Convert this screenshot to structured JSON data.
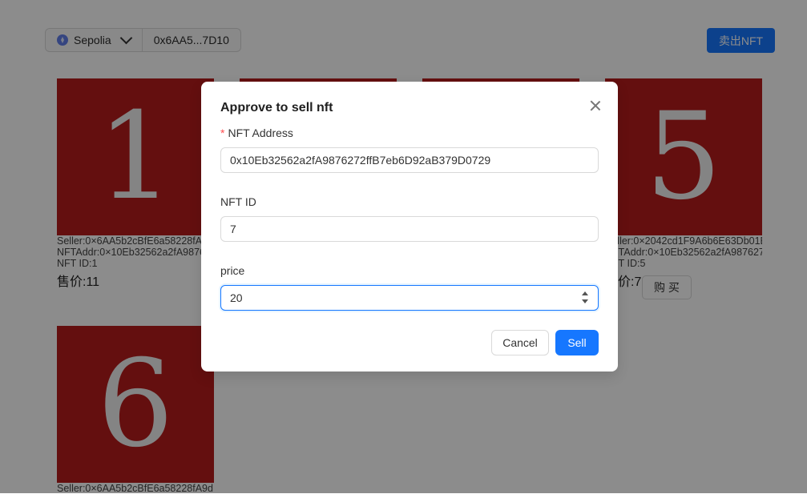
{
  "header": {
    "network": "Sepolia",
    "account": "0x6AA5...7D10",
    "sell_button": "卖出NFT"
  },
  "cards": [
    {
      "number": "1",
      "seller": "Seller:0×6AA5b2cBfE6a58228fA9d",
      "nft_addr": "NFTAddr:0×10Eb32562a2fA9876272ffB7",
      "nft_id": "NFT ID:1",
      "price": "售价:11"
    },
    {
      "number": "5",
      "seller": "Seller:0×2042cd1F9A6b6E63Db01E",
      "nft_addr": "NFTAddr:0×10Eb32562a2fA9876272",
      "nft_id": "NFT ID:5",
      "price": "售价:7",
      "buy": "购 买"
    },
    {
      "number": "6",
      "seller": "Seller:0×6AA5b2cBfE6a58228fA9d"
    }
  ],
  "modal": {
    "title": "Approve to sell nft",
    "nft_address_label": "NFT Address",
    "nft_address_value": "0x10Eb32562a2fA9876272ffB7eb6D92aB379D0729",
    "nft_id_label": "NFT ID",
    "nft_id_value": "7",
    "price_label": "price",
    "price_value": "20",
    "cancel": "Cancel",
    "sell": "Sell"
  },
  "colors": {
    "primary": "#1677ff",
    "card_bg": "#b71c1c",
    "overlay": "rgba(0,0,0,0.45)"
  }
}
